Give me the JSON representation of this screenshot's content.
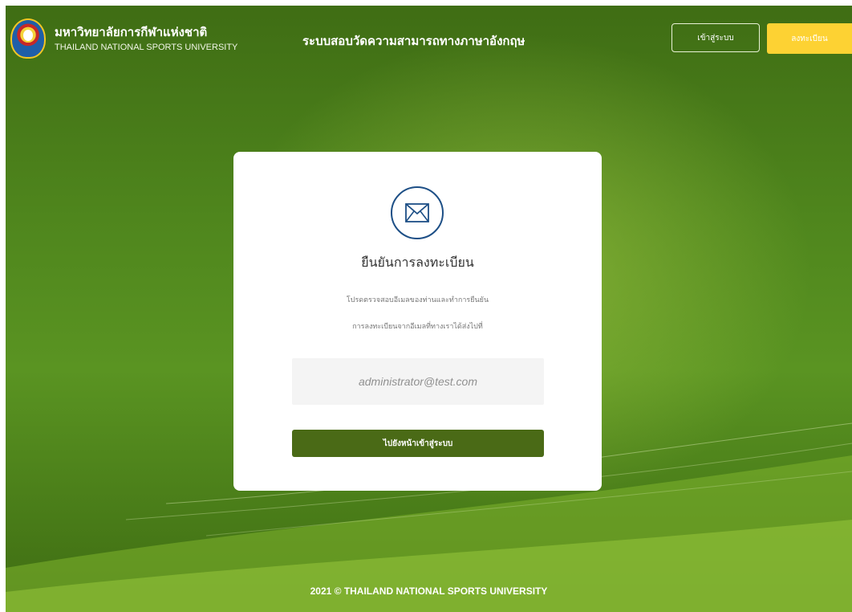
{
  "header": {
    "university_name_th": "มหาวิทยาลัยการกีฬาแห่งชาติ",
    "university_name_en": "THAILAND NATIONAL SPORTS UNIVERSITY",
    "system_title": "ระบบสอบวัดความสามารถทางภาษาอังกฤษ",
    "login_label": "เข้าสู่ระบบ",
    "register_label": "ลงทะเบียน"
  },
  "card": {
    "icon": "envelope-icon",
    "title": "ยืนยันการลงทะเบียน",
    "description_line1": "โปรดตรวจสอบอีเมลของท่านและทำการยืนยัน",
    "description_line2": "การลงทะเบียนจากอีเมลที่ทางเราได้ส่งไปที่",
    "email": "administrator@test.com",
    "button_label": "ไปยังหน้าเข้าสู่ระบบ"
  },
  "footer": {
    "text": "2021 © THAILAND NATIONAL SPORTS UNIVERSITY"
  },
  "colors": {
    "background_green": "#4f861d",
    "register_button": "#fdd233",
    "primary_button": "#4a6a16",
    "icon_blue": "#1d4f86"
  }
}
